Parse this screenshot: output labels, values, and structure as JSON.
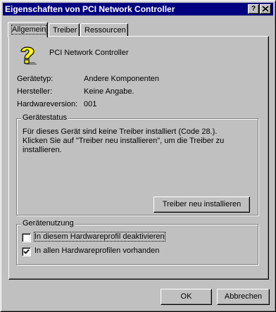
{
  "window": {
    "title": "Eigenschaften von PCI Network Controller",
    "help_btn": "?",
    "close_btn": "✕"
  },
  "tabs": [
    {
      "label": "Allgemein",
      "active": true
    },
    {
      "label": "Treiber",
      "active": false
    },
    {
      "label": "Ressourcen",
      "active": false
    }
  ],
  "device": {
    "icon": "unknown-device-question-icon",
    "name": "PCI Network Controller"
  },
  "properties": [
    {
      "label": "Gerätetyp:",
      "value": "Andere Komponenten"
    },
    {
      "label": "Hersteller:",
      "value": "Keine Angabe."
    },
    {
      "label": "Hardwareversion:",
      "value": "001"
    }
  ],
  "status_group": {
    "title": "Gerätestatus",
    "message": "Für dieses Gerät sind keine Treiber installiert  (Code 28.). Klicken Sie auf \"Treiber neu installieren\", um die Treiber zu installieren.",
    "reinstall_button": "Treiber neu installieren"
  },
  "usage_group": {
    "title": "Gerätenutzung",
    "options": [
      {
        "label": "In diesem Hardwareprofil deaktivieren",
        "checked": false
      },
      {
        "label": "In allen Hardwareprofilen vorhanden",
        "checked": true
      }
    ]
  },
  "buttons": {
    "ok": "OK",
    "cancel": "Abbrechen"
  }
}
